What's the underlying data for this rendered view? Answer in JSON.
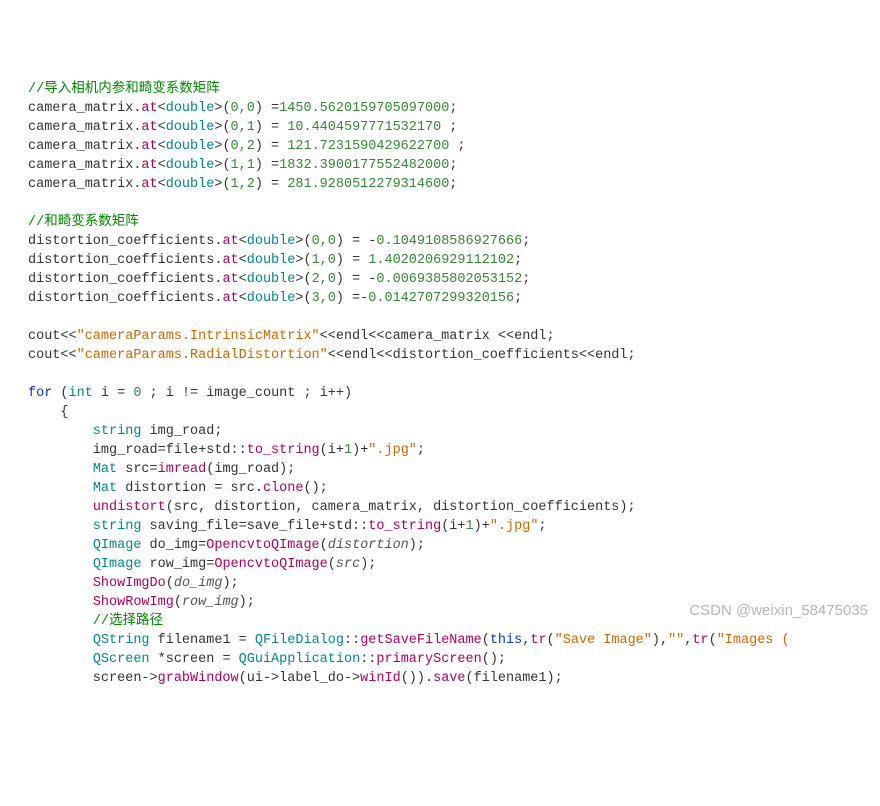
{
  "code": {
    "comment_intro": "//导入相机内参和畸变系数矩阵",
    "cm": [
      {
        "var": "camera_matrix",
        "at": ".at<",
        "type": "double",
        "close": ">(",
        "index": "0,0",
        "after": ") =",
        "value": "1450.5620159705097000",
        "tail": ";"
      },
      {
        "var": "camera_matrix",
        "at": ".at<",
        "type": "double",
        "close": ">(",
        "index": "0,1",
        "after": ") = ",
        "value": "10.4404597771532170",
        "tail": " ;"
      },
      {
        "var": "camera_matrix",
        "at": ".at<",
        "type": "double",
        "close": ">(",
        "index": "0,2",
        "after": ") = ",
        "value": "121.7231590429622700",
        "tail": " ;"
      },
      {
        "var": "camera_matrix",
        "at": ".at<",
        "type": "double",
        "close": ">(",
        "index": "1,1",
        "after": ") =",
        "value": "1832.3900177552482000",
        "tail": ";"
      },
      {
        "var": "camera_matrix",
        "at": ".at<",
        "type": "double",
        "close": ">(",
        "index": "1,2",
        "after": ") = ",
        "value": "281.9280512279314600",
        "tail": ";"
      }
    ],
    "comment_dist": "//和畸变系数矩阵",
    "dc": [
      {
        "var": "distortion_coefficients",
        "at": ".at<",
        "type": "double",
        "close": ">(",
        "index": "0,0",
        "after": ") = ",
        "minus": "-",
        "value": "0.1049108586927666",
        "tail": ";"
      },
      {
        "var": "distortion_coefficients",
        "at": ".at<",
        "type": "double",
        "close": ">(",
        "index": "1,0",
        "after": ") = ",
        "minus": "",
        "value": "1.4020206929112102",
        "tail": ";"
      },
      {
        "var": "distortion_coefficients",
        "at": ".at<",
        "type": "double",
        "close": ">(",
        "index": "2,0",
        "after": ") = ",
        "minus": "-",
        "value": "0.0069385802053152",
        "tail": ";"
      },
      {
        "var": "distortion_coefficients",
        "at": ".at<",
        "type": "double",
        "close": ">(",
        "index": "3,0",
        "after": ") =",
        "minus": "-",
        "value": "0.0142707299320156",
        "tail": ";"
      }
    ],
    "cout1": {
      "p1": "cout<<",
      "s": "\"cameraParams.IntrinsicMatrix\"",
      "p2": "<<endl<<",
      "v": "camera_matrix ",
      "p3": "<<endl;"
    },
    "cout2": {
      "p1": "cout<<",
      "s": "\"cameraParams.RadialDistortion\"",
      "p2": "<<endl<<",
      "v": "distortion_coefficients",
      "p3": "<<endl;"
    },
    "for_kw": "for",
    "for_open": " (",
    "for_type": "int",
    "for_decl": " i = ",
    "for_zero": "0",
    "for_cond": " ; i != image_count ; i++)",
    "brace_open": "{",
    "l_string": "string",
    "l_img_road_decl": " img_road;",
    "l_img_road_assign_a": "img_road=",
    "l_file": "file",
    "l_plus1": "+",
    "l_std": "std",
    "l_colons": "::",
    "l_to_string": "to_string",
    "l_idx": "(i+",
    "l_one": "1",
    "l_idx_close": ")+",
    "l_jpg": "\".jpg\"",
    "l_semicolon": ";",
    "l_mat": "Mat",
    "l_src_decl": " src=",
    "l_imread": "imread",
    "l_imread_args": "(img_road);",
    "l_distortion_decl": " distortion = src.",
    "l_clone": "clone",
    "l_clone_args": "();",
    "l_undistort": "undistort",
    "l_undistort_args": "(src, distortion, camera_matrix, distortion_coefficients);",
    "l_saving_file_a": " saving_file=",
    "l_save_file": "save_file",
    "l_qimage": "QImage",
    "l_do_img_decl": " do_img=",
    "l_ocv": "OpencvtoQImage",
    "l_do_arg": "distortion",
    "l_row_img_decl": " row_img=",
    "l_row_arg": "src",
    "l_show_do": "ShowImgDo",
    "l_show_do_arg": "do_img",
    "l_show_row": "ShowRowImg",
    "l_show_row_arg": "row_img",
    "comment_path": "//选择路径",
    "l_qstring": "QString",
    "l_filename_decl": " filename1 = ",
    "l_qfd": "QFileDialog",
    "l_getsave": "getSaveFileName",
    "l_this": "this",
    "l_tr": "tr",
    "l_save_image": "\"Save Image\"",
    "l_empty": "\"\"",
    "l_images": "\"Images (",
    "l_qscreen": "QScreen",
    "l_screen_decl": " *screen = ",
    "l_qgui": "QGuiApplication",
    "l_primary": "primaryScreen",
    "l_screen_arrow": "screen->",
    "l_grab": "grabWindow",
    "l_ui_arrow": "(ui->",
    "l_label_do": "label_do",
    "l_arrow": "->",
    "l_winid": "winId",
    "l_winid_close": "()).",
    "l_save": "save",
    "l_save_args": "(filename1);"
  },
  "watermark": "CSDN @weixin_58475035"
}
